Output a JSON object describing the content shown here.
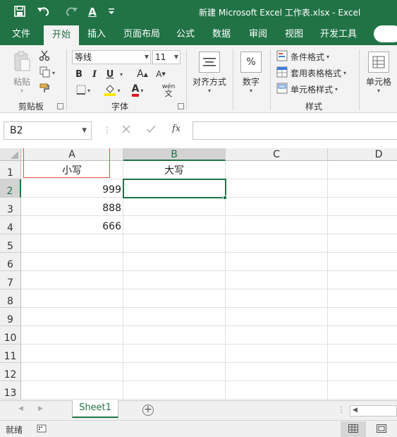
{
  "window": {
    "title": "新建 Microsoft Excel 工作表.xlsx  -  Excel"
  },
  "quick_access": {
    "save_icon": "save-icon",
    "undo_icon": "undo-icon",
    "redo_icon": "redo-icon",
    "font_color_letter": "A",
    "customize_icon": "dropdown-icon"
  },
  "ribbon_tabs": [
    {
      "label": "文件",
      "active": false
    },
    {
      "label": "开始",
      "active": true
    },
    {
      "label": "插入",
      "active": false
    },
    {
      "label": "页面布局",
      "active": false
    },
    {
      "label": "公式",
      "active": false
    },
    {
      "label": "数据",
      "active": false
    },
    {
      "label": "审阅",
      "active": false
    },
    {
      "label": "视图",
      "active": false
    },
    {
      "label": "开发工具",
      "active": false
    }
  ],
  "clipboard": {
    "paste_label": "粘贴",
    "group_label": "剪贴板"
  },
  "font": {
    "font_name": "等线",
    "font_size": "11",
    "bold": "B",
    "italic": "I",
    "underline": "U",
    "grow": "A",
    "shrink": "A",
    "font_color": "A",
    "phonetic": "wén",
    "phonetic_sub": "文",
    "group_label": "字体"
  },
  "alignment": {
    "label": "对齐方式"
  },
  "number": {
    "symbol": "%",
    "label": "数字"
  },
  "styles": {
    "conditional": "条件格式",
    "table_format": "套用表格格式",
    "cell_styles": "单元格样式",
    "group_label": "样式"
  },
  "cells": {
    "label": "单元格"
  },
  "formula_bar": {
    "name_box": "B2",
    "fx": "fx",
    "formula_value": ""
  },
  "grid": {
    "columns": [
      "A",
      "B",
      "C",
      "D"
    ],
    "rows": [
      "1",
      "2",
      "3",
      "4",
      "5",
      "6",
      "7",
      "8",
      "9",
      "10",
      "11",
      "12",
      "13"
    ],
    "cells": {
      "A1": "小写",
      "B1": "大写",
      "A2": "999",
      "A3": "888",
      "A4": "666"
    },
    "selected_cell": "B2"
  },
  "sheets": {
    "tabs": [
      "Sheet1"
    ],
    "active": "Sheet1"
  },
  "status": {
    "text": "就绪"
  },
  "colors": {
    "accent": "#217346",
    "highlight_box": "#e0524a"
  }
}
